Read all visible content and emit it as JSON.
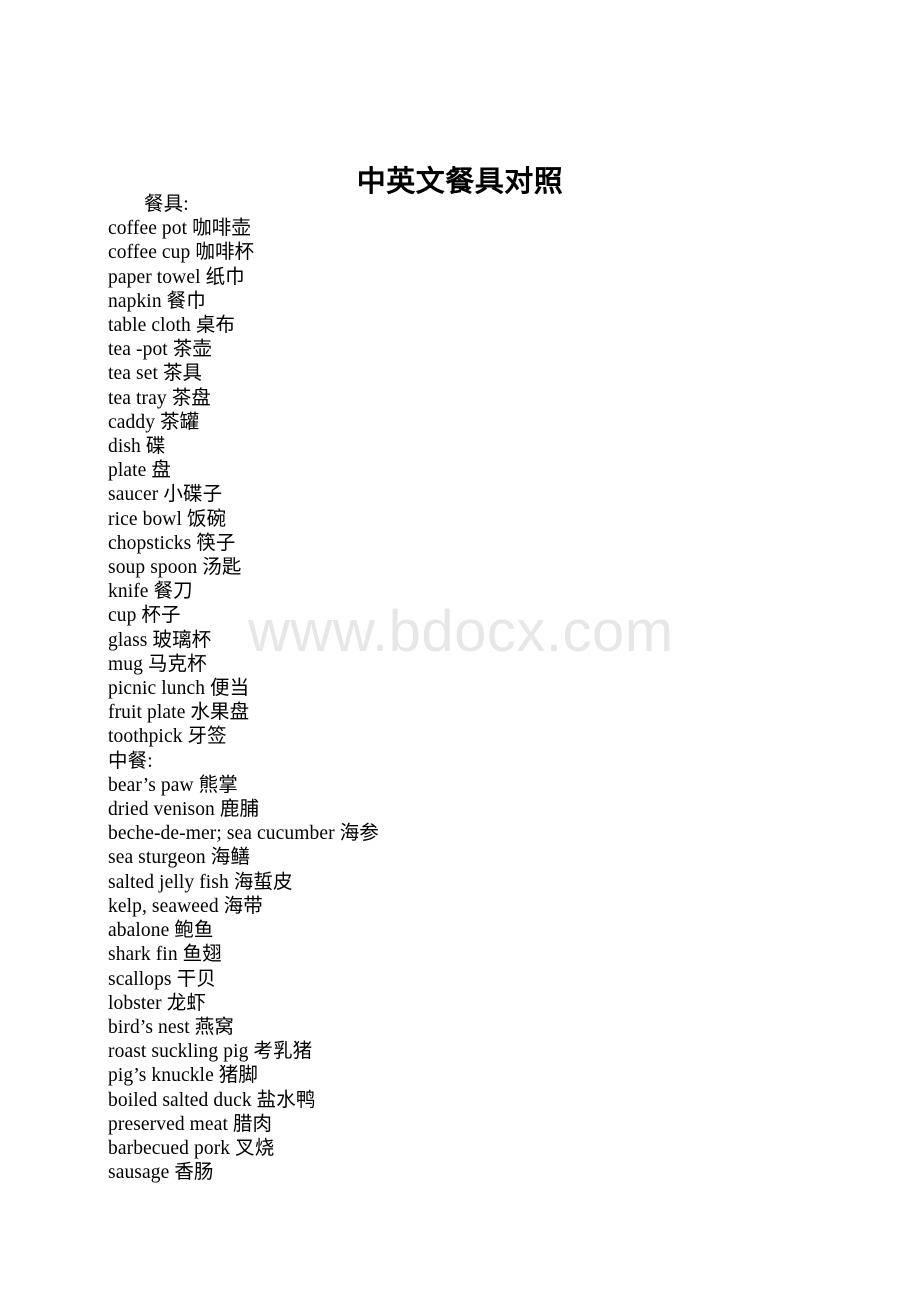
{
  "document": {
    "title": "中英文餐具对照",
    "watermark": "www.bdocx.com"
  },
  "entries": [
    {
      "text": "餐具:",
      "indented": true
    },
    {
      "text": "coffee pot 咖啡壶",
      "indented": false
    },
    {
      "text": "coffee cup 咖啡杯",
      "indented": false
    },
    {
      "text": "paper towel 纸巾",
      "indented": false
    },
    {
      "text": "napkin 餐巾",
      "indented": false
    },
    {
      "text": "table cloth 桌布",
      "indented": false
    },
    {
      "text": "tea -pot 茶壶",
      "indented": false
    },
    {
      "text": "tea set 茶具",
      "indented": false
    },
    {
      "text": "tea tray 茶盘",
      "indented": false
    },
    {
      "text": "caddy 茶罐",
      "indented": false
    },
    {
      "text": "dish 碟",
      "indented": false
    },
    {
      "text": "plate 盘",
      "indented": false
    },
    {
      "text": "saucer 小碟子",
      "indented": false
    },
    {
      "text": "rice bowl 饭碗",
      "indented": false
    },
    {
      "text": "chopsticks 筷子",
      "indented": false
    },
    {
      "text": "soup spoon 汤匙",
      "indented": false
    },
    {
      "text": "knife 餐刀",
      "indented": false
    },
    {
      "text": "cup 杯子",
      "indented": false
    },
    {
      "text": "glass 玻璃杯",
      "indented": false
    },
    {
      "text": "mug 马克杯",
      "indented": false
    },
    {
      "text": "picnic lunch 便当",
      "indented": false
    },
    {
      "text": "fruit plate 水果盘",
      "indented": false
    },
    {
      "text": "toothpick 牙签",
      "indented": false
    },
    {
      "text": "中餐:",
      "indented": false
    },
    {
      "text": "bear’s paw 熊掌",
      "indented": false
    },
    {
      "text": "dried venison 鹿脯",
      "indented": false
    },
    {
      "text": "beche-de-mer; sea cucumber 海参",
      "indented": false
    },
    {
      "text": "sea sturgeon 海鳝",
      "indented": false
    },
    {
      "text": "salted jelly fish 海蜇皮",
      "indented": false
    },
    {
      "text": "kelp, seaweed 海带",
      "indented": false
    },
    {
      "text": "abalone 鲍鱼",
      "indented": false
    },
    {
      "text": "shark fin 鱼翅",
      "indented": false
    },
    {
      "text": "scallops 干贝",
      "indented": false
    },
    {
      "text": "lobster 龙虾",
      "indented": false
    },
    {
      "text": "bird’s nest 燕窝",
      "indented": false
    },
    {
      "text": "roast suckling pig 考乳猪",
      "indented": false
    },
    {
      "text": "pig’s knuckle 猪脚",
      "indented": false
    },
    {
      "text": "boiled salted duck 盐水鸭",
      "indented": false
    },
    {
      "text": "preserved meat 腊肉",
      "indented": false
    },
    {
      "text": "barbecued pork 叉烧",
      "indented": false
    },
    {
      "text": "sausage 香肠",
      "indented": false
    }
  ]
}
